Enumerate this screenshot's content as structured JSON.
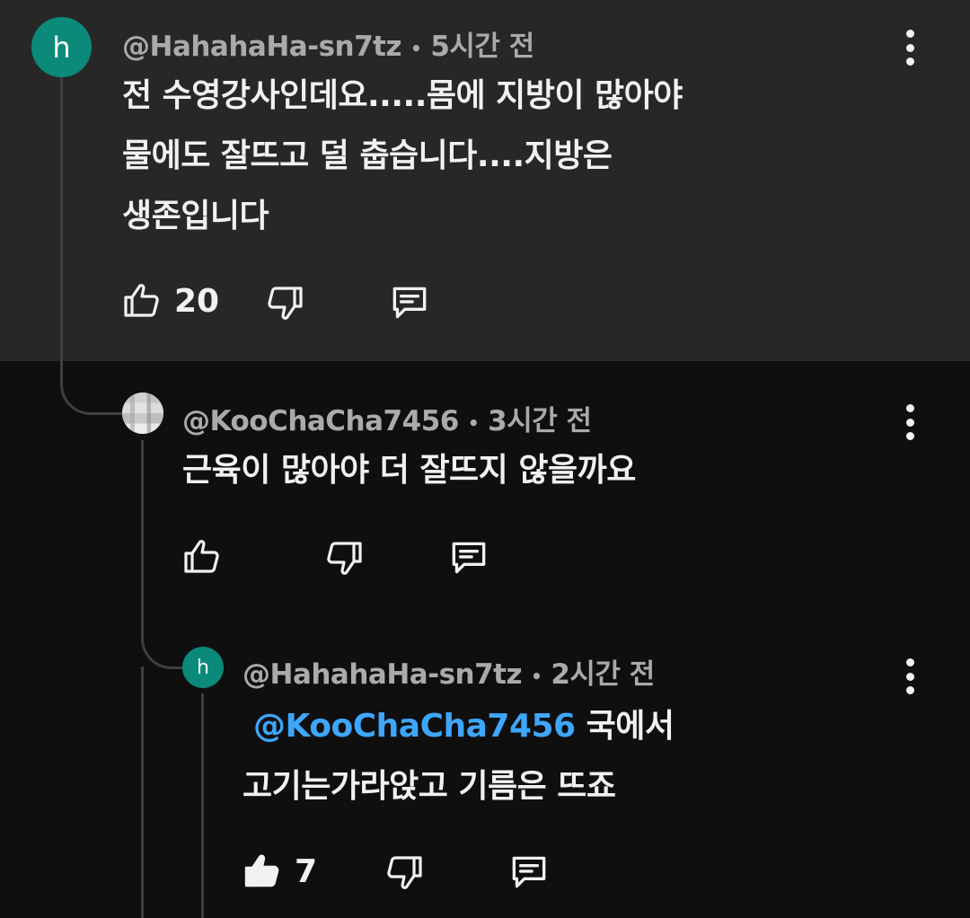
{
  "comments": [
    {
      "avatar_letter": "h",
      "author": "@HahahaHa-sn7tz",
      "separator": "•",
      "time": "5시간 전",
      "lines": [
        "전 수영강사인데요.....몸에 지방이 많아야",
        "물에도 잘뜨고 덜 춥습니다....지방은",
        "생존입니다"
      ],
      "like_count": "20",
      "like_filled": false,
      "highlighted": true
    },
    {
      "avatar_letter": "",
      "author": "@KooChaCha7456",
      "separator": "•",
      "time": "3시간 전",
      "lines": [
        "근육이 많아야 더 잘뜨지 않을까요"
      ],
      "like_count": "",
      "like_filled": false
    },
    {
      "avatar_letter": "h",
      "author": "@HahahaHa-sn7tz",
      "separator": "•",
      "time": "2시간 전",
      "mention": "@KooChaCha7456",
      "lines": [
        "국에서",
        "고기는가라앉고 기름은 뜨죠"
      ],
      "like_count": "7",
      "like_filled": true
    }
  ],
  "icons": {
    "like": "thumbs-up-icon",
    "dislike": "thumbs-down-icon",
    "reply": "reply-icon",
    "more": "more-vertical-icon"
  },
  "colors": {
    "background": "#0f0f0f",
    "highlight": "#272727",
    "avatar": "#0b8a7a",
    "mention": "#3ea6ff",
    "meta": "#aaaaaa"
  }
}
